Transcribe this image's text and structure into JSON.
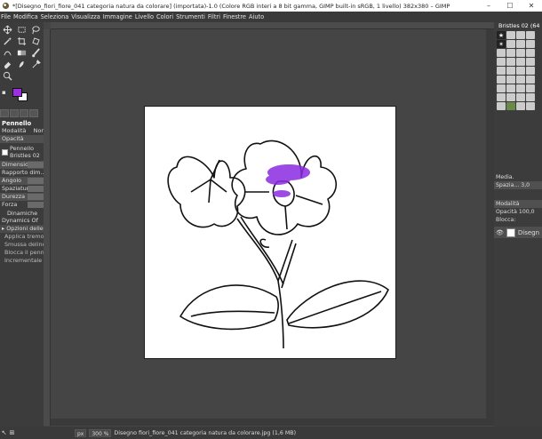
{
  "window": {
    "title": "*[Disegno_fiori_fiore_041 categoria natura da colorare] (importata)-1.0 (Colore RGB interi a 8 bit gamma, GIMP built-in sRGB, 1 livello) 382x380 – GIMP",
    "minimize": "–",
    "maximize": "☐",
    "close": "✕"
  },
  "menu": [
    "File",
    "Modifica",
    "Seleziona",
    "Visualizza",
    "Immagine",
    "Livello",
    "Colori",
    "Strumenti",
    "Filtri",
    "Finestre",
    "Aiuto"
  ],
  "tool_options": {
    "title": "Pennello",
    "mode_label": "Modalità",
    "mode_value": "Nor",
    "opacity": "Opacità",
    "brush_label": "Pennello",
    "brush_value": "Bristles 02",
    "size": "Dimensione",
    "aspect": "Rapporto dim...",
    "angle": "Angolo",
    "spacing": "Spaziatura",
    "hardness": "Durezza",
    "force": "Forza",
    "dynamics_label": "Dinamiche",
    "dynamics_value": "Dynamics Of",
    "dyn_options": "Opzioni delle d",
    "apply_jitter": "Applica tremol",
    "smooth": "Smussa delinea",
    "lock_brush": "Blocca il penne",
    "incremental": "Incrementale"
  },
  "fg_color": "#9b30e0",
  "bg_color": "#ffffff",
  "brushes_panel": {
    "title": "Bristles 02 (64"
  },
  "layers_panel": {
    "media": "Media.",
    "spacing": "Spazia...",
    "spacing_val": "3,0",
    "mode": "Modalità",
    "opacity": "Opacità",
    "opacity_val": "100,0",
    "lock": "Blocca:",
    "layer_name": "Disegn"
  },
  "status": {
    "unit": "px",
    "zoom": "300 %",
    "file": "Disegno fiori_fiore_041 categoria natura da colorare.jpg (1,6 MB)"
  }
}
